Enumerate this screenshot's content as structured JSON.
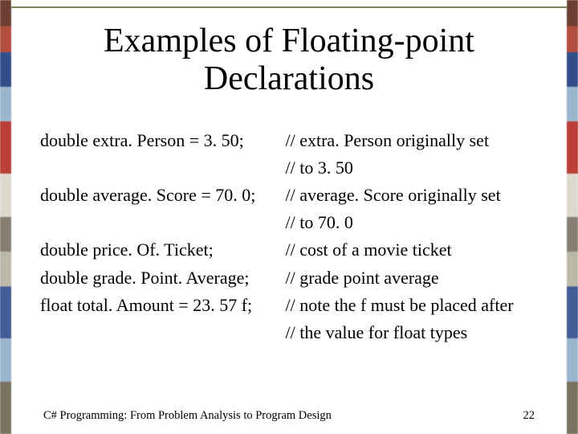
{
  "title": "Examples of Floating-point Declarations",
  "lines": [
    {
      "decl": "double extra. Person = 3. 50;",
      "comment": "// extra. Person originally set"
    },
    {
      "decl": "",
      "comment": "// to 3. 50"
    },
    {
      "decl": "double average. Score = 70. 0;",
      "comment": "// average. Score originally set"
    },
    {
      "decl": "",
      "comment": "// to 70. 0"
    },
    {
      "decl": "double price. Of. Ticket;",
      "comment": "// cost of a movie ticket"
    },
    {
      "decl": "double grade. Point. Average;",
      "comment": "// grade point average"
    },
    {
      "decl": "float total. Amount = 23. 57 f;",
      "comment": "// note the f must be placed after"
    },
    {
      "decl": "",
      "comment": "// the value for float types"
    }
  ],
  "footer": {
    "left": "C# Programming: From Problem Analysis to Program Design",
    "right": "22"
  }
}
